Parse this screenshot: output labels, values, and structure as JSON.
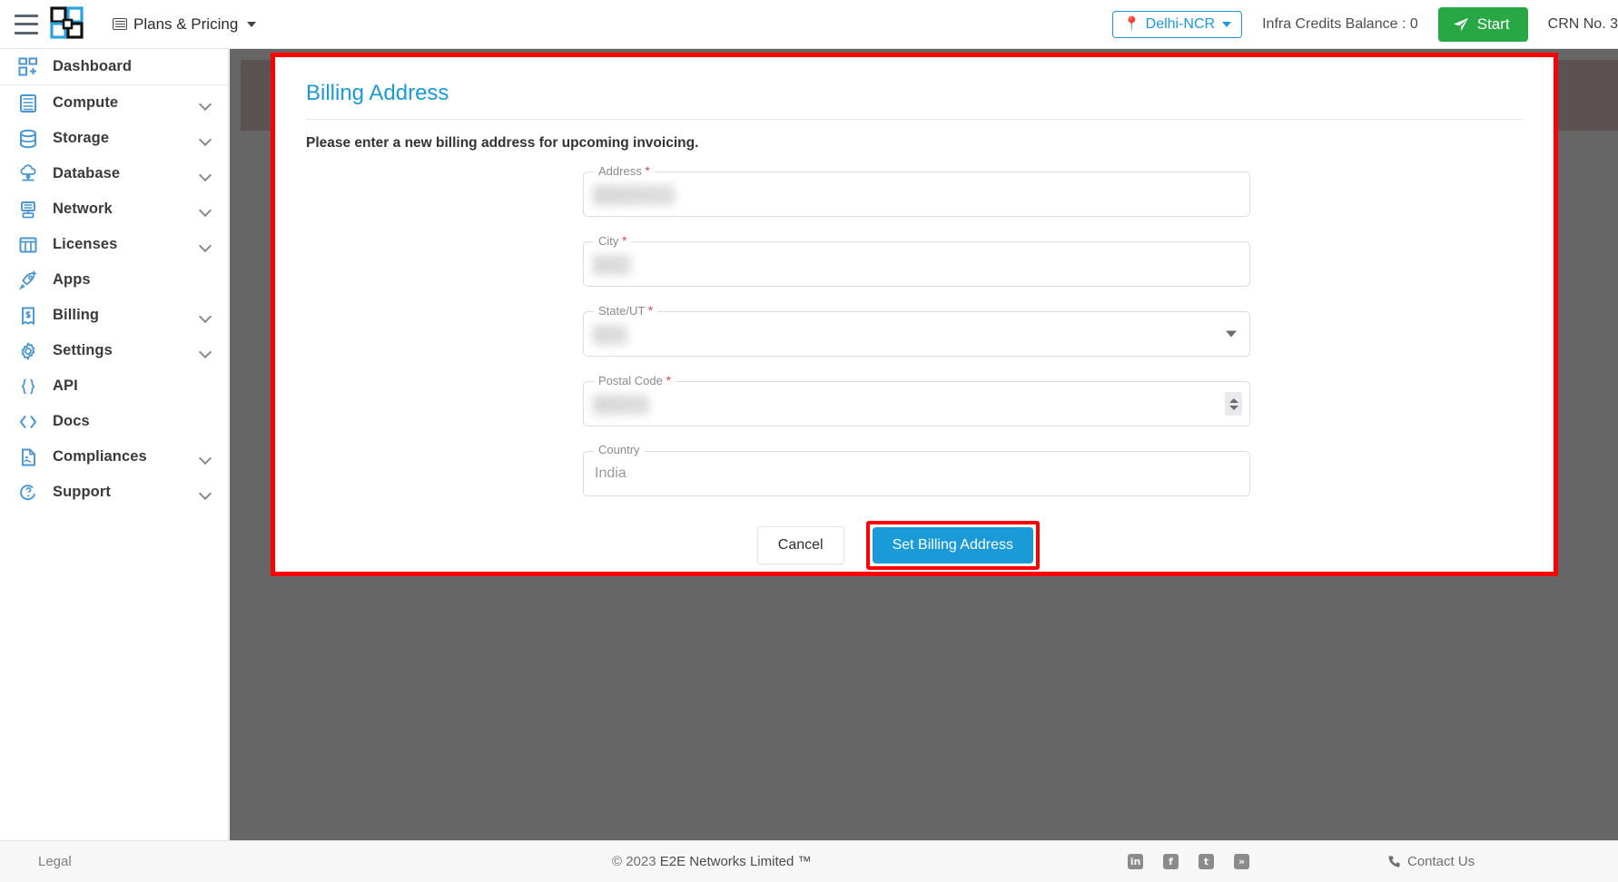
{
  "topbar": {
    "menu_icon": "hamburger-icon",
    "logo_alt": "E2E Networks",
    "plans_label": "Plans & Pricing",
    "region_label": "Delhi-NCR",
    "credits_label": "Infra Credits Balance : 0",
    "start_label": "Start",
    "crn_label": "CRN No. 3"
  },
  "sidebar": {
    "items": [
      {
        "label": "Dashboard",
        "icon": "dashboard-icon",
        "expandable": false
      },
      {
        "label": "Compute",
        "icon": "server-icon",
        "expandable": true
      },
      {
        "label": "Storage",
        "icon": "database-icon",
        "expandable": true
      },
      {
        "label": "Database",
        "icon": "cloud-db-icon",
        "expandable": true
      },
      {
        "label": "Network",
        "icon": "network-icon",
        "expandable": true
      },
      {
        "label": "Licenses",
        "icon": "licenses-icon",
        "expandable": true
      },
      {
        "label": "Apps",
        "icon": "rocket-icon",
        "expandable": false
      },
      {
        "label": "Billing",
        "icon": "invoice-icon",
        "expandable": true
      },
      {
        "label": "Settings",
        "icon": "gear-icon",
        "expandable": true
      },
      {
        "label": "API",
        "icon": "braces-icon",
        "expandable": false
      },
      {
        "label": "Docs",
        "icon": "code-icon",
        "expandable": false
      },
      {
        "label": "Compliances",
        "icon": "document-icon",
        "expandable": true
      },
      {
        "label": "Support",
        "icon": "help-icon",
        "expandable": true
      }
    ]
  },
  "modal": {
    "title": "Billing Address",
    "subtitle": "Please enter a new billing address for upcoming invoicing.",
    "fields": [
      {
        "label": "Address",
        "required": true,
        "value": "",
        "type": "text",
        "blur_width": 90
      },
      {
        "label": "City",
        "required": true,
        "value": "",
        "type": "text",
        "blur_width": 42
      },
      {
        "label": "State/UT",
        "required": true,
        "value": "",
        "type": "select",
        "blur_width": 38
      },
      {
        "label": "Postal Code",
        "required": true,
        "value": "",
        "type": "number",
        "blur_width": 62
      },
      {
        "label": "Country",
        "required": false,
        "value": "India",
        "type": "text",
        "blur_width": 0
      }
    ],
    "cancel_label": "Cancel",
    "submit_label": "Set Billing Address",
    "highlight_color": "#ff0000",
    "accent_color": "#1a9ad7"
  },
  "footer": {
    "legal_label": "Legal",
    "copyright_prefix": "© 2023",
    "copyright_company": "E2E Networks Limited ™",
    "socials": [
      {
        "name": "linkedin-icon",
        "glyph": "in"
      },
      {
        "name": "facebook-icon",
        "glyph": "f"
      },
      {
        "name": "twitter-icon",
        "glyph": "t"
      },
      {
        "name": "rss-icon",
        "glyph": "»"
      }
    ],
    "contact_label": "Contact Us"
  }
}
